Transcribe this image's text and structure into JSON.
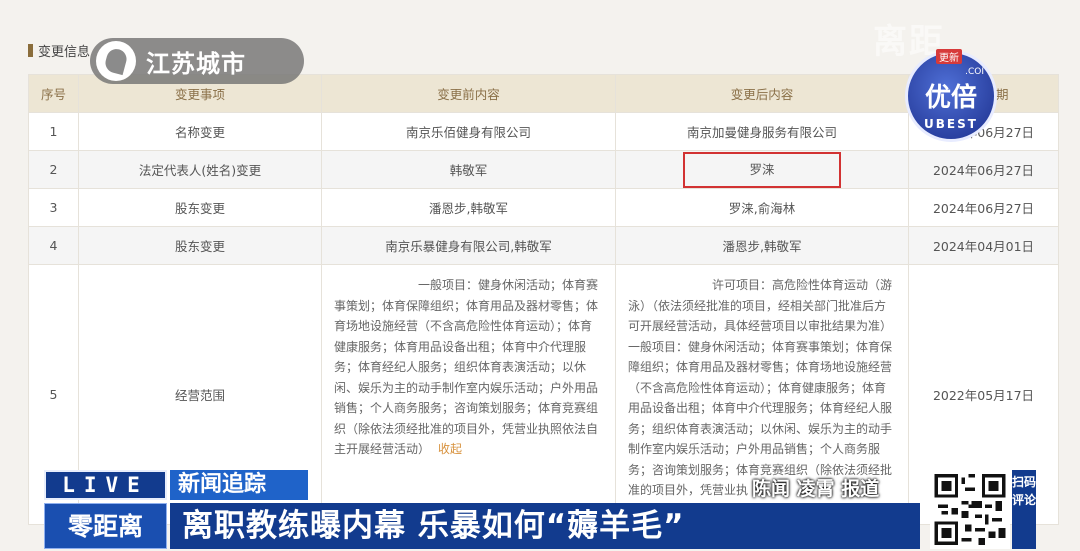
{
  "section": {
    "title": "变更信息"
  },
  "table": {
    "headers": [
      "序号",
      "变更事项",
      "变更前内容",
      "变更后内容",
      "变更日期"
    ],
    "rows": [
      {
        "no": "1",
        "item": "名称变更",
        "before": "南京乐佰健身有限公司",
        "after": "南京加曼健身服务有限公司",
        "date": "2024年06月27日"
      },
      {
        "no": "2",
        "item": "法定代表人(姓名)变更",
        "before": "韩敬军",
        "after": "罗涞",
        "date": "2024年06月27日"
      },
      {
        "no": "3",
        "item": "股东变更",
        "before": "潘恩步,韩敬军",
        "after": "罗涞,俞海林",
        "date": "2024年06月27日"
      },
      {
        "no": "4",
        "item": "股东变更",
        "before": "南京乐暴健身有限公司,韩敬军",
        "after": "潘恩步,韩敬军",
        "date": "2024年04月01日"
      },
      {
        "no": "5",
        "item": "经营范围",
        "before": "一般项目：健身休闲活动；体育赛事策划；体育保障组织；体育用品及器材零售；体育场地设施经营（不含高危险性体育运动）；体育健康服务；体育用品设备出租；体育中介代理服务；体育经纪人服务；组织体育表演活动；以休闲、娱乐为主的动手制作室内娱乐活动；户外用品销售；个人商务服务；咨询策划服务；体育竞赛组织（除依法须经批准的项目外，凭营业执照依法自主开展经营活动）",
        "before_action": "收起",
        "after": "许可项目：高危险性体育运动（游泳）（依法须经批准的项目，经相关部门批准后方可开展经营活动，具体经营项目以审批结果为准）一般项目：健身休闲活动；体育赛事策划；体育保障组织；体育用品及器材零售；体育场地设施经营（不含高危险性体育运动）；体育健康服务；体育用品设备出租；体育中介代理服务；体育经纪人服务；组织体育表演活动；以休闲、娱乐为主的动手制作室内娱乐活动；户外用品销售；个人商务服务；咨询策划服务；体育竞赛组织（除依法须经批准的项目外，凭营业执",
        "date": "2022年05月17日"
      }
    ]
  },
  "overlay": {
    "channel_logo": "江苏城市",
    "top_right_watermark": "离距",
    "badge": {
      "cn": "优倍",
      "en": "UBEST",
      "dot": ".COI",
      "tag": "更新"
    },
    "live": "LIVE",
    "topic": "新闻追踪",
    "brand": "零距离",
    "headline": "离职教练曝内幕 乐暴如何“薅羊毛”",
    "reporter": "陈闻 凌霄 报道",
    "qr_side": "扫码评论"
  },
  "colors": {
    "header_bg": "#ede6d4",
    "header_text": "#8a7048",
    "highlight_border": "#d23232",
    "collapse_link": "#d7913c",
    "tv_blue_dark": "#123b8e",
    "tv_blue": "#1f63c9"
  }
}
